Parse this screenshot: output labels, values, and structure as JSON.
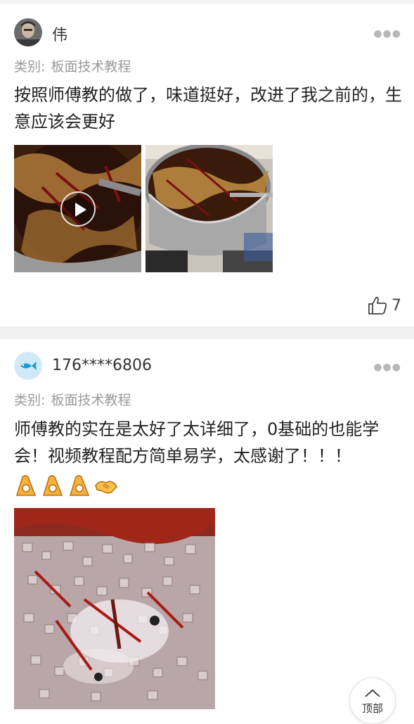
{
  "posts": [
    {
      "username": "伟",
      "category_label": "类别:",
      "category_value": "板面技术教程",
      "text": "按照师傅教的做了，味道挺好，改进了我之前的，生意应该会更好",
      "likes": "7"
    },
    {
      "username": "176****6806",
      "category_label": "类别:",
      "category_value": "板面技术教程",
      "text": "师傅教的实在是太好了太详细了，0基础的也能学会！视频教程配方简单易学，太感谢了！！！",
      "emojis": [
        "ok-hand-icon",
        "ok-hand-icon",
        "ok-hand-icon",
        "handshake-icon"
      ]
    }
  ],
  "back_to_top": "顶部"
}
